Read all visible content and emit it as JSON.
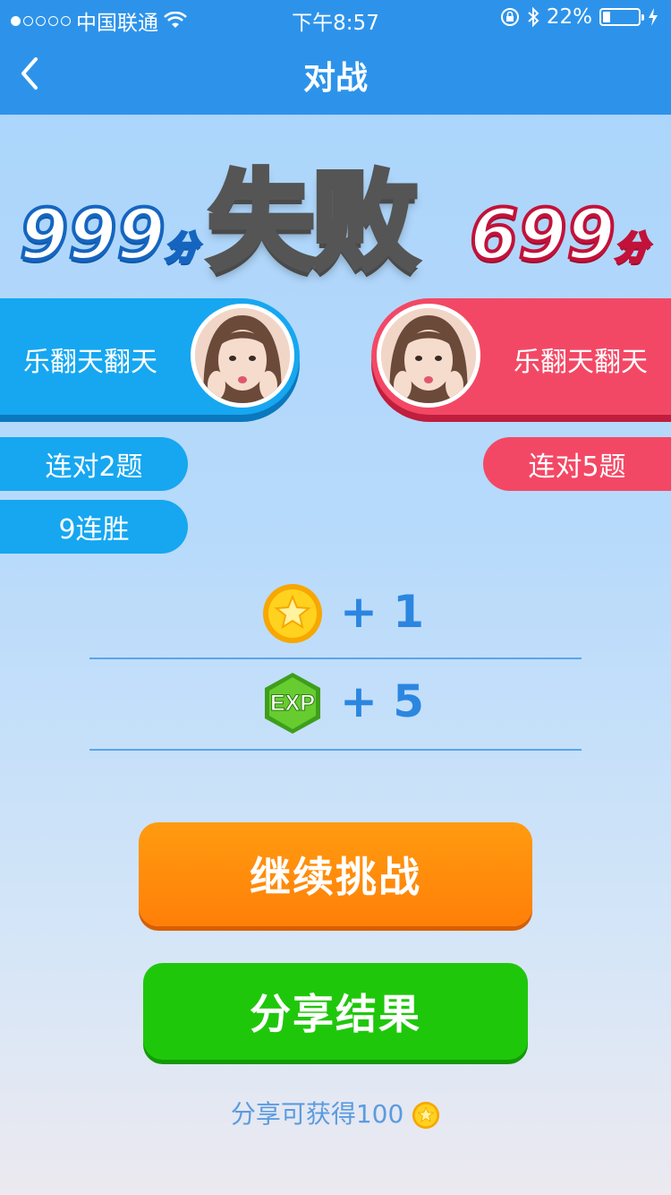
{
  "status_bar": {
    "carrier": "中国联通",
    "time": "下午8:57",
    "battery": "22%",
    "battery_level": 0.22
  },
  "nav": {
    "title": "对战"
  },
  "result": {
    "label": "失败",
    "my_score": "999",
    "opponent_score": "699",
    "score_unit": "分"
  },
  "players": {
    "me": {
      "name": "乐翻天翻天"
    },
    "opponent": {
      "name": "乐翻天翻天"
    }
  },
  "streaks": {
    "me": [
      "连对2题",
      "9连胜"
    ],
    "opponent": [
      "连对5题"
    ]
  },
  "rewards": {
    "coins": "+ 1",
    "exp_label": "EXP",
    "exp": "+ 5"
  },
  "buttons": {
    "continue": "继续挑战",
    "share": "分享结果"
  },
  "share_hint": "分享可获得100",
  "colors": {
    "header": "#2d93ea",
    "player_blue": "#16a7f0",
    "player_red": "#f34865",
    "continue_orange": "#ff8c0c",
    "share_green": "#1fc70b"
  }
}
